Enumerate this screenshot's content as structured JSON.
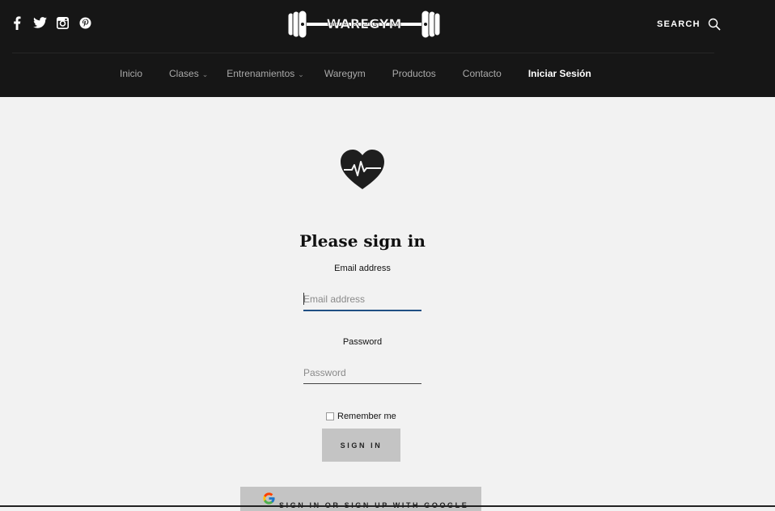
{
  "header": {
    "logo_text": "WAREGYM",
    "search_label": "SEARCH",
    "social": [
      {
        "icon": "facebook-icon"
      },
      {
        "icon": "twitter-icon"
      },
      {
        "icon": "instagram-icon"
      },
      {
        "icon": "pinterest-icon"
      }
    ]
  },
  "nav": {
    "items": [
      {
        "label": "Inicio"
      },
      {
        "label": "Clases"
      },
      {
        "label": "Entrenamientos"
      },
      {
        "label": "Waregym"
      },
      {
        "label": "Productos"
      },
      {
        "label": "Contacto"
      },
      {
        "label": "Iniciar Sesión"
      }
    ]
  },
  "form": {
    "heading": "Please sign in",
    "email_label": "Email address",
    "email_placeholder": "Email address",
    "password_label": "Password",
    "password_placeholder": "Password",
    "remember_label": "Remember me",
    "signin_label": "SIGN IN",
    "google_label": "SIGN IN OR SIGN UP WITH GOOGLE"
  },
  "colors": {
    "header_bg": "#161616",
    "page_bg": "#f2f2f2",
    "button_bg": "#c4c4c4",
    "focus_underline": "#1f4f84"
  }
}
